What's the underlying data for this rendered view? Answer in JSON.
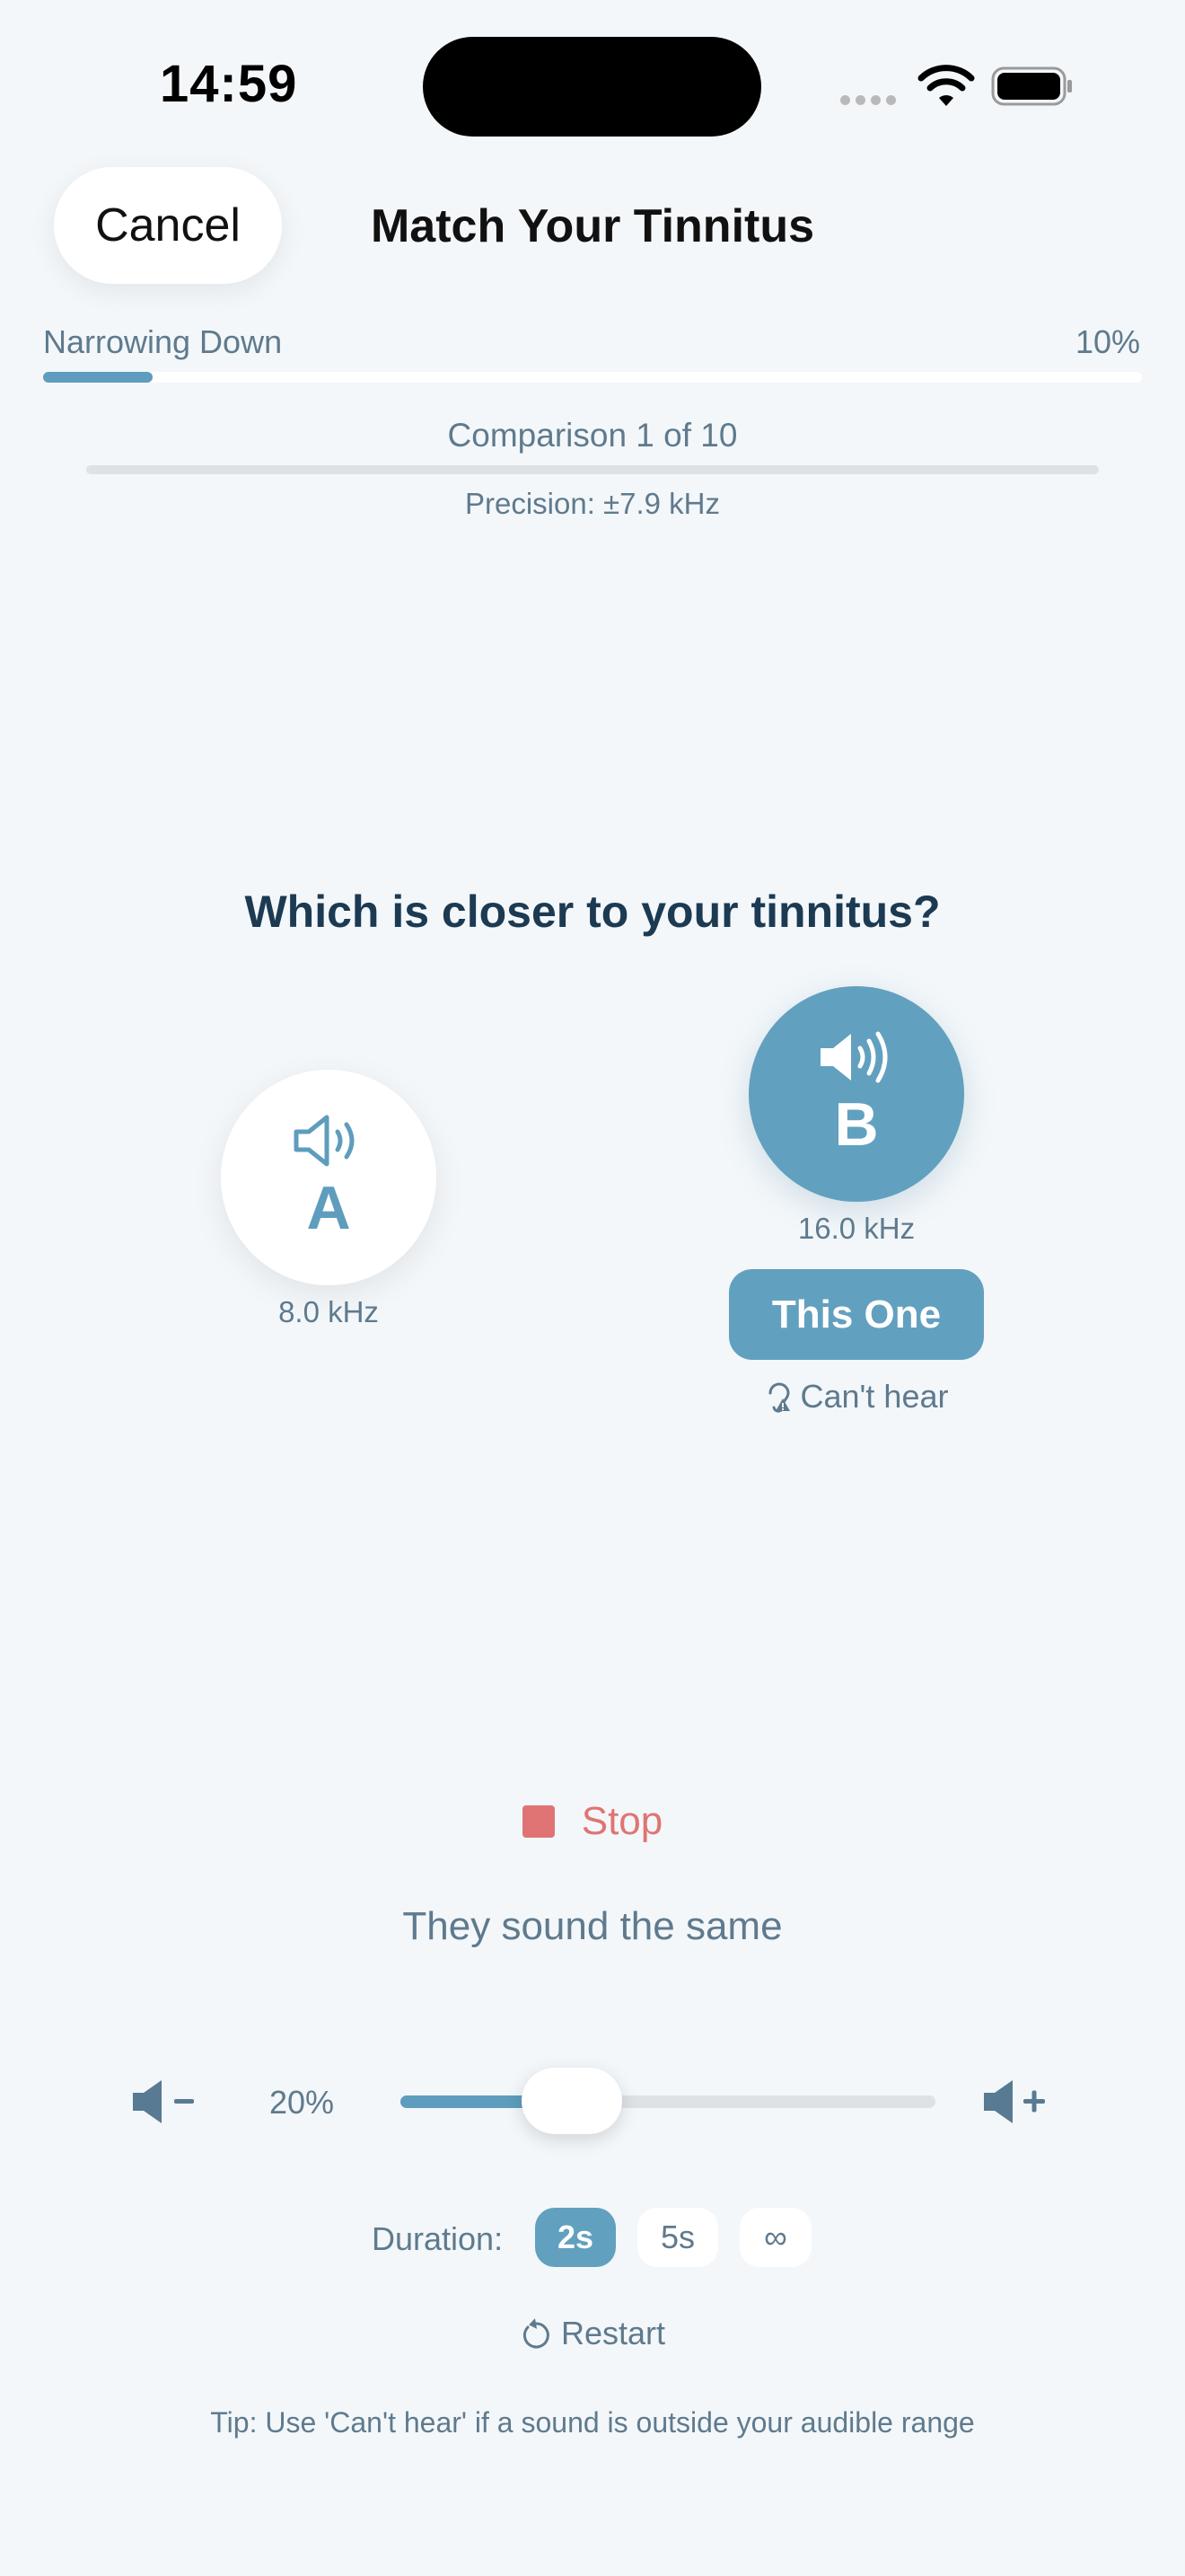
{
  "status_bar": {
    "time": "14:59"
  },
  "nav": {
    "cancel_label": "Cancel",
    "title": "Match Your Tinnitus"
  },
  "progress": {
    "stage_label": "Narrowing Down",
    "percent_label": "10%",
    "value": 0.1
  },
  "comparison": {
    "label": "Comparison 1 of 10",
    "precision": "Precision: ±7.9 kHz"
  },
  "question": "Which is closer to your tinnitus?",
  "tones": {
    "a": {
      "letter": "A",
      "frequency": "8.0 kHz",
      "icon": "speaker-outline-icon"
    },
    "b": {
      "letter": "B",
      "frequency": "16.0 kHz",
      "icon": "speaker-filled-icon",
      "playing": true
    }
  },
  "select_label": "This One",
  "cant_hear_label": "Can't hear",
  "stop_label": "Stop",
  "same_label": "They sound the same",
  "volume": {
    "label": "20%",
    "value": 0.32
  },
  "duration": {
    "label": "Duration:",
    "options": [
      "2s",
      "5s",
      "∞"
    ],
    "selected": "2s"
  },
  "restart_label": "Restart",
  "tip": "Tip: Use 'Can't hear' if a sound is outside your audible range",
  "colors": {
    "accent": "#62a0bf",
    "stop": "#e07474",
    "muted_text": "#5f7a8d",
    "title_text": "#1c3a52",
    "background": "#f3f7fa"
  }
}
